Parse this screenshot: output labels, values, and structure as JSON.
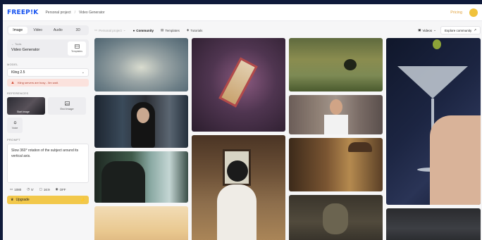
{
  "header": {
    "logo": "FREEP!K",
    "breadcrumb": [
      "Personal project",
      "Video Generator"
    ],
    "pricing": "Pricing"
  },
  "sidebar": {
    "tabs": [
      {
        "label": "Image",
        "active": true
      },
      {
        "label": "Video",
        "active": false
      },
      {
        "label": "Audio",
        "active": false
      },
      {
        "label": "3D",
        "active": false
      }
    ],
    "tool": {
      "small": "← Tools",
      "title": "Video Generator",
      "button": "Templates"
    },
    "model_label": "MODEL",
    "model_value": "Kling 2.5",
    "warning": "Kling servers are busy - 5m wait.",
    "references_label": "REFERENCES",
    "start_image": "Start image",
    "end_image": "End image",
    "voice": "Voice",
    "prompt_label": "PROMPT",
    "prompt_text": "Slow 360° rotation of the subject around its vertical axis.",
    "settings": {
      "resolution": "1080",
      "duration": "5'",
      "ratio": "16:9",
      "audio": "OFF"
    },
    "upgrade": "Upgrade"
  },
  "toolbar": {
    "project": "Personal project",
    "community": "Community",
    "templates": "Templates",
    "tutorials": "Tutorials",
    "filter": "Videos",
    "explore": "Explore community"
  },
  "colors": {
    "accent": "#1350f0",
    "pricing": "#e0a13c",
    "upgrade": "#f2c84b",
    "warning_bg": "#fbe2dd",
    "frame": "#0f1a3a"
  }
}
